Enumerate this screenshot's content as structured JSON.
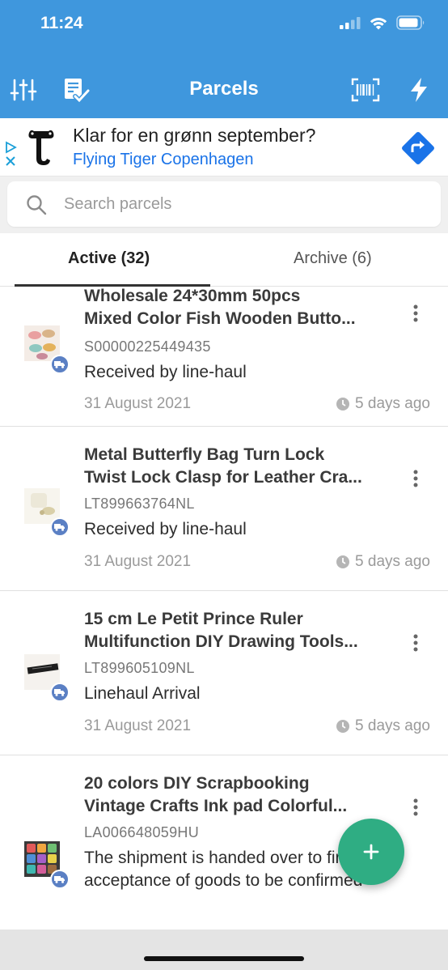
{
  "status_bar": {
    "time": "11:24"
  },
  "header": {
    "title": "Parcels"
  },
  "ad": {
    "headline": "Klar for en grønn september?",
    "advertiser": "Flying Tiger Copenhagen",
    "logo_letter": "t"
  },
  "search": {
    "placeholder": "Search parcels",
    "value": ""
  },
  "tabs": [
    {
      "label": "Active (32)",
      "selected": true
    },
    {
      "label": "Archive (6)",
      "selected": false
    }
  ],
  "parcels": [
    {
      "title_line1": "Wholesale 24*30mm 50pcs",
      "title_line2": "Mixed Color Fish  Wooden Butto...",
      "tracking": "S00000225449435",
      "status": "Received by line-haul",
      "date": "31 August 2021",
      "ago": "5 days ago"
    },
    {
      "title_line1": "Metal Butterfly Bag Turn Lock",
      "title_line2": "Twist Lock Clasp for Leather Cra...",
      "tracking": "LT899663764NL",
      "status": "Received by line-haul",
      "date": "31 August 2021",
      "ago": "5 days ago"
    },
    {
      "title_line1": "15 cm Le Petit Prince Ruler",
      "title_line2": "Multifunction DIY Drawing Tools...",
      "tracking": "LT899605109NL",
      "status": "Linehaul Arrival",
      "date": "31 August 2021",
      "ago": "5 days ago"
    },
    {
      "title_line1": "20 colors DIY Scrapbooking",
      "title_line2": "Vintage Crafts Ink pad Colorful...",
      "tracking": "LA006648059HU",
      "status": "The shipment is handed over to final acceptance of goods to be confirmed"
    }
  ],
  "colors": {
    "header": "#3f97dd",
    "fab": "#2fad83",
    "truck_badge": "#5b80c4",
    "ad_link": "#1a73e8"
  },
  "icons": {
    "filter": "sliders-icon",
    "tasks": "checklist-icon",
    "scan": "barcode-scan-icon",
    "quick": "lightning-icon",
    "add": "plus-icon"
  }
}
